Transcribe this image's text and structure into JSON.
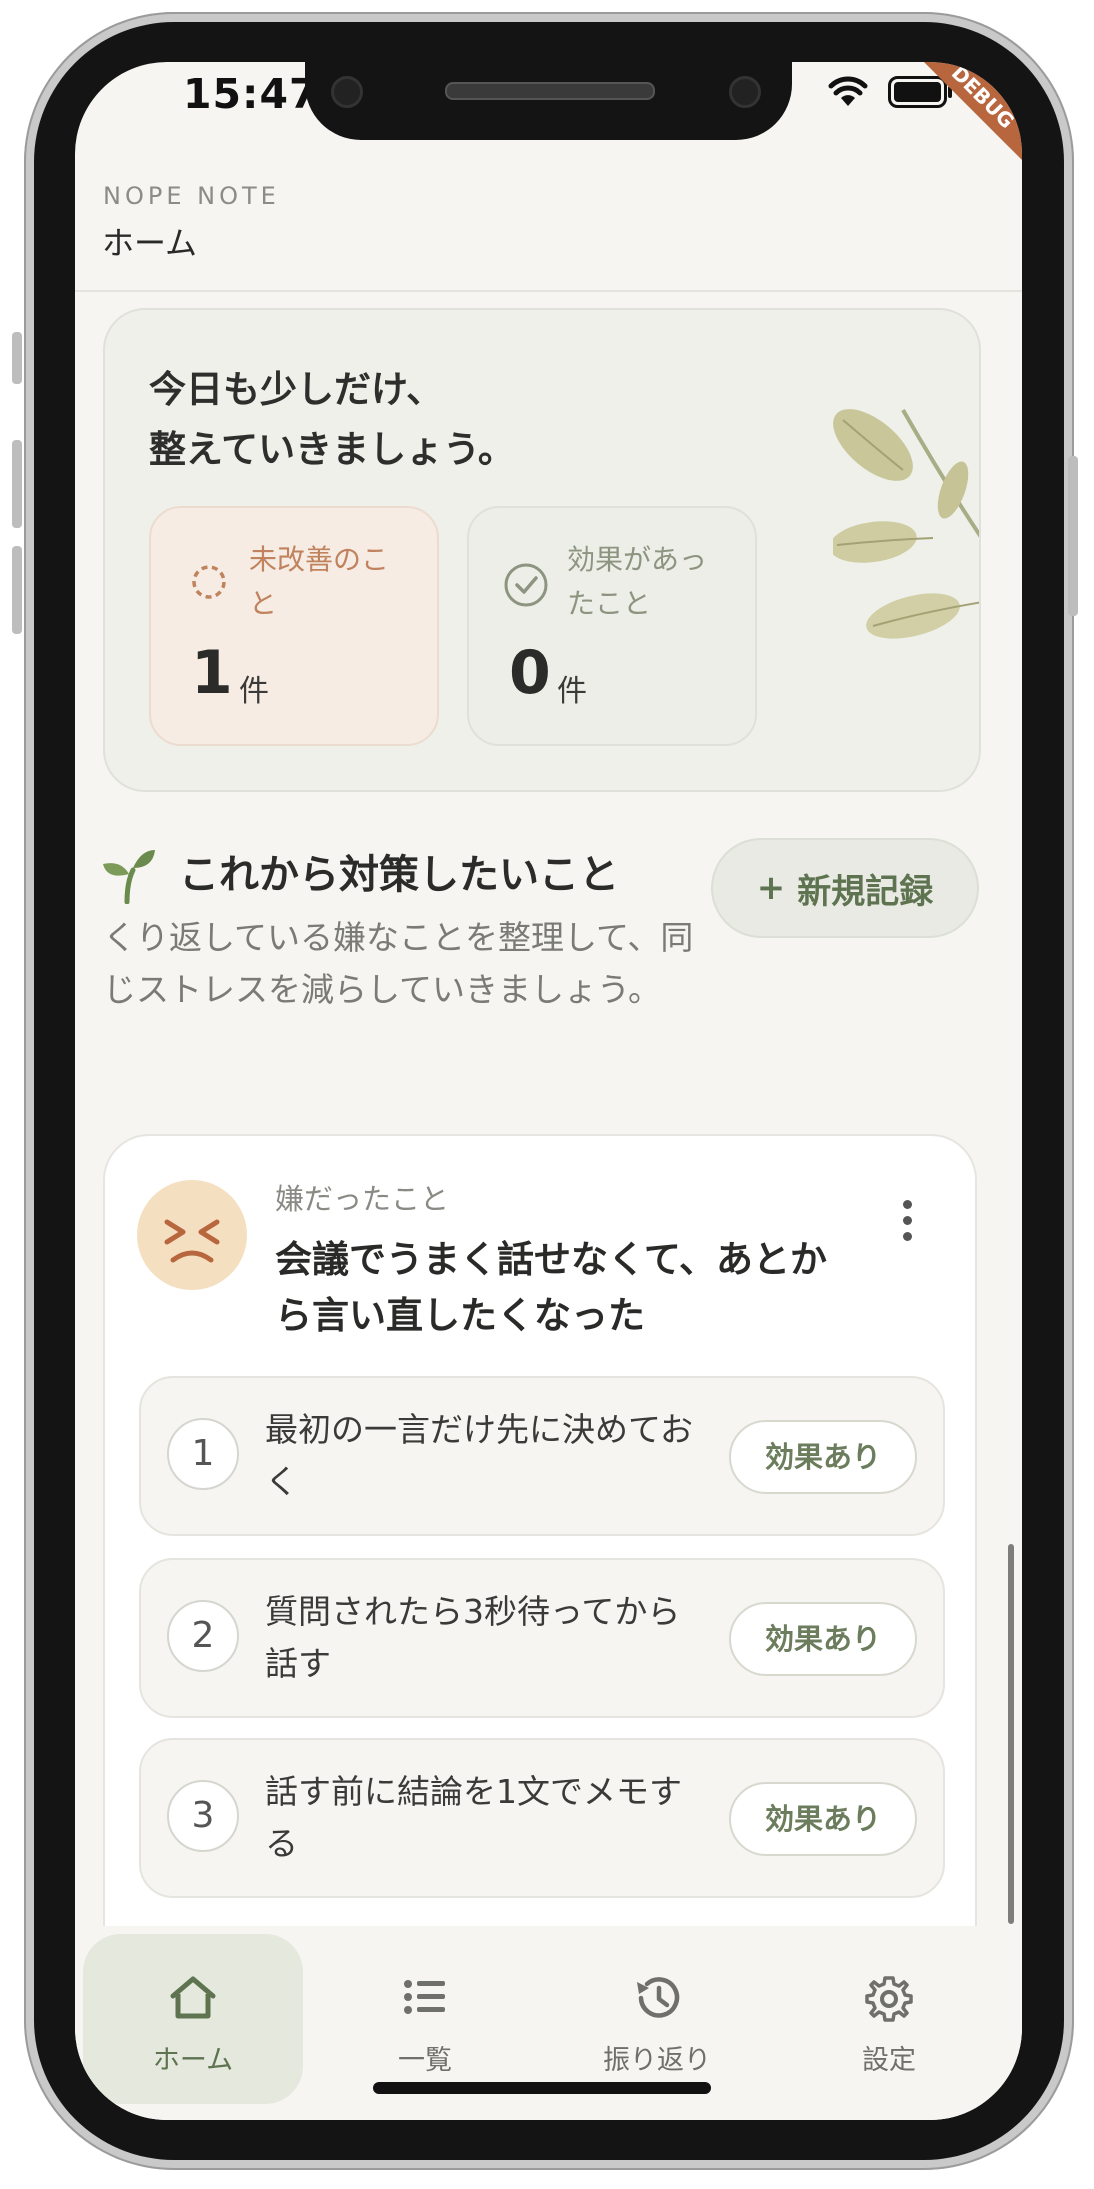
{
  "status_bar": {
    "time": "15:47",
    "debug": "DEBUG"
  },
  "app_bar": {
    "eyebrow": "NOPE NOTE",
    "title": "ホーム"
  },
  "hero": {
    "greeting_line1": "今日も少しだけ、",
    "greeting_line2": "整えていきましょう。",
    "stats": [
      {
        "label": "未改善のこと",
        "count": "1",
        "unit": "件",
        "icon": "dashed-circle-icon",
        "color": "#c0835d"
      },
      {
        "label": "効果があったこと",
        "count": "0",
        "unit": "件",
        "icon": "check-circle-icon",
        "color": "#8d9480"
      }
    ]
  },
  "section": {
    "title": "これから対策したいこと",
    "description": "くり返している嫌なことを整理して、同じストレスを減らしていきましょう。",
    "new_button": "新規記録",
    "new_button_prefix": "+"
  },
  "entry": {
    "label": "嫌だったこと",
    "text": "会議でうまく話せなくて、あとから言い直したくなった",
    "steps": [
      {
        "number": "1",
        "text": "最初の一言だけ先に決めておく",
        "button": "効果あり"
      },
      {
        "number": "2",
        "text": "質問されたら3秒待ってから話す",
        "button": "効果あり"
      },
      {
        "number": "3",
        "text": "話す前に結論を1文でメモする",
        "button": "効果あり"
      }
    ]
  },
  "nav": [
    {
      "label": "ホーム",
      "icon": "home-icon",
      "active": true
    },
    {
      "label": "一覧",
      "icon": "list-icon",
      "active": false
    },
    {
      "label": "振り返り",
      "icon": "history-icon",
      "active": false
    },
    {
      "label": "設定",
      "icon": "gear-icon",
      "active": false
    }
  ],
  "colors": {
    "accent": "#5e7350",
    "warm": "#c0835d",
    "background": "#f6f5f1"
  }
}
